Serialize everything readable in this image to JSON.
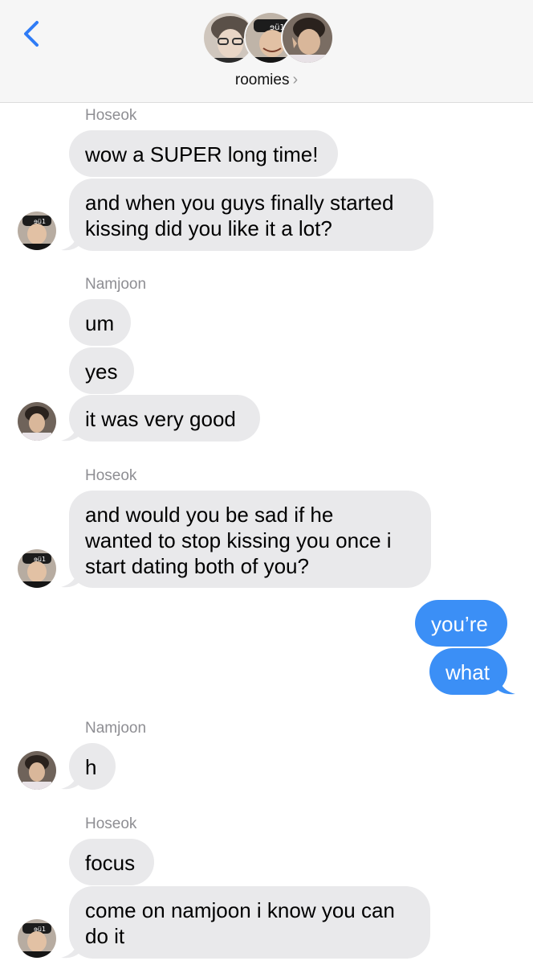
{
  "header": {
    "group_name": "roomies",
    "chevron": "›"
  },
  "colors": {
    "incoming_bubble": "#e9e9eb",
    "outgoing_bubble": "#3b8ff6",
    "back_arrow": "#2f7cf6",
    "sender_label": "#8e8e93"
  },
  "conversation": {
    "senders": [
      "Hoseok",
      "Namjoon",
      "Hoseok",
      "Namjoon",
      "Hoseok"
    ],
    "messages": [
      "wow a SUPER long time!",
      "and when you guys finally started\nkissing did you like it a lot?",
      "um",
      "yes",
      "it was very good",
      "and would you be sad if he\nwanted to stop kissing you once i\nstart dating both of you?",
      "you’re",
      "what",
      "h",
      "focus",
      "come on namjoon i know you can\ndo it"
    ]
  }
}
